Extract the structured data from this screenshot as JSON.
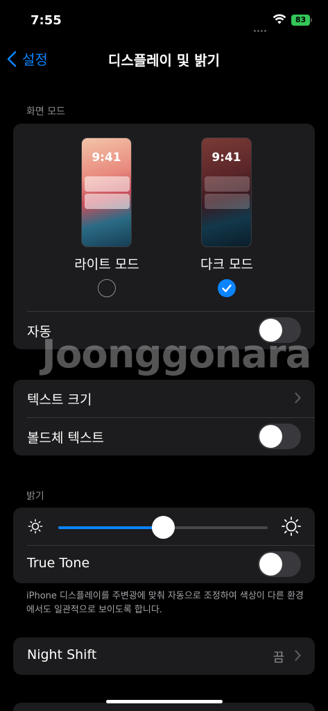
{
  "status": {
    "time": "7:55",
    "battery": "83"
  },
  "nav": {
    "back_label": "설정",
    "title": "디스플레이 및 밝기"
  },
  "appearance": {
    "section_label": "화면 모드",
    "light": {
      "preview_time": "9:41",
      "label": "라이트 모드",
      "selected": false
    },
    "dark": {
      "preview_time": "9:41",
      "label": "다크 모드",
      "selected": true
    },
    "auto_label": "자동",
    "auto_on": false
  },
  "text": {
    "text_size_label": "텍스트 크기",
    "bold_label": "볼드체 텍스트",
    "bold_on": false
  },
  "brightness": {
    "section_label": "밝기",
    "level": 0.5,
    "true_tone_label": "True Tone",
    "true_tone_on": false,
    "footnote": "iPhone 디스플레이를 주변광에 맞춰 자동으로 조정하여 색상이 다른 환경에서도 일관적으로 보이도록 합니다."
  },
  "night_shift": {
    "label": "Night Shift",
    "value": "끔"
  },
  "watermark": "Joonggonara",
  "colors": {
    "accent": "#0a84ff",
    "group_bg": "#1c1c1e",
    "battery": "#34c759"
  }
}
